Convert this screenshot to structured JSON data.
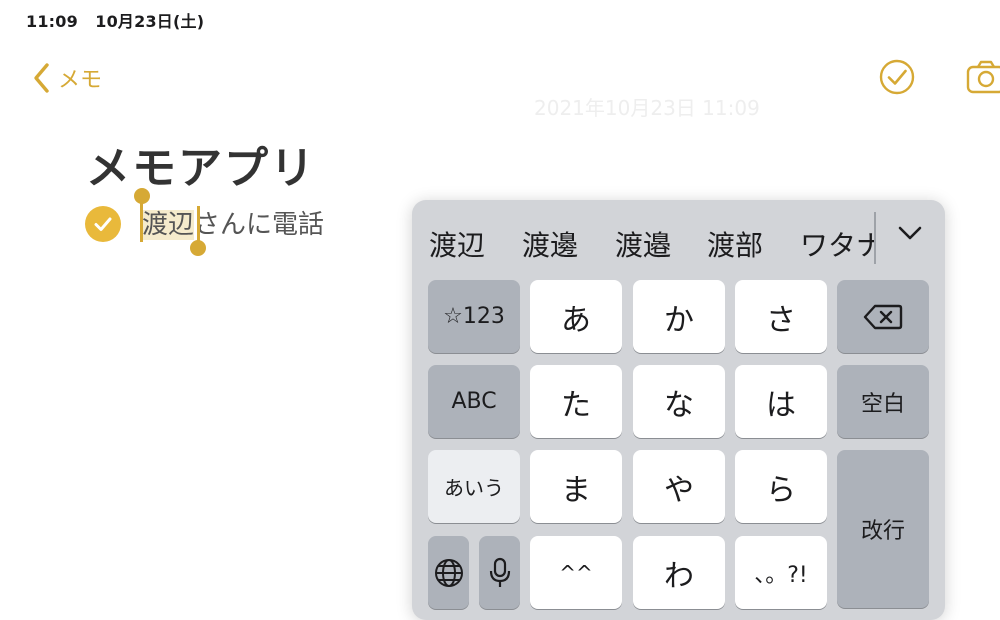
{
  "status": {
    "time": "11:09",
    "date": "10月23日(土)"
  },
  "nav": {
    "back_label": "メモ",
    "icons": [
      "chevron-left-icon",
      "checklist-circle-icon",
      "camera-icon"
    ],
    "accent": "#d6a935"
  },
  "note": {
    "timestamp": "2021年10月23日 11:09",
    "title": "メモアプリ",
    "item_selected": "渡辺",
    "item_rest": "さんに電話",
    "item_checked": true
  },
  "keyboard": {
    "candidates": [
      "渡辺",
      "渡邊",
      "渡邉",
      "渡部",
      "ワタナ"
    ],
    "keys": {
      "numbers": "☆123",
      "a": "あ",
      "ka": "か",
      "sa": "さ",
      "abc": "ABC",
      "ta": "た",
      "na": "な",
      "ha": "は",
      "space": "空白",
      "kana": "あいう",
      "ma": "ま",
      "ya": "や",
      "ra": "ら",
      "enter": "改行",
      "emoticon": "^^",
      "wa": "わ",
      "punct": "、。?!"
    },
    "icons": [
      "chevron-down-icon",
      "delete-backspace-icon",
      "globe-icon",
      "microphone-icon"
    ]
  }
}
